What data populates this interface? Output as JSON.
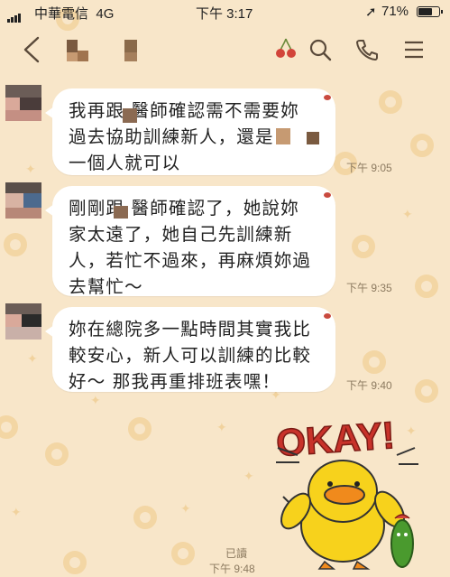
{
  "status_bar": {
    "carrier": "中華電信",
    "network": "4G",
    "time": "下午 3:17",
    "battery_percent": "71%",
    "battery_level": 0.71
  },
  "nav": {
    "icons": [
      "back-icon",
      "cherry-icon",
      "search-icon",
      "phone-icon",
      "menu-icon"
    ]
  },
  "messages": [
    {
      "text": "我再跟   醫師確認需不需要妳\n過去協助訓練新人，還是\n一個人就可以",
      "time": "下午 9:05"
    },
    {
      "text": "剛剛跟   醫師確認了，她說妳\n家太遠了，她自己先訓練新\n人，若忙不過來，再麻煩妳過\n去幫忙～",
      "time": "下午 9:35"
    },
    {
      "text": "妳在總院多一點時間其實我比\n較安心，新人可以訓練的比較\n好～ 那我再重排班表嘿！",
      "time": "下午 9:40"
    }
  ],
  "sticker": {
    "text": "OKAY!",
    "character": "yellow-duck-sticker"
  },
  "outgoing": {
    "read_label": "已讀",
    "time": "下午 9:48"
  },
  "colors": {
    "background": "#f8e6c9",
    "bubble": "#ffffff",
    "sticker_red": "#c8322a",
    "duck_yellow": "#f7d21c"
  }
}
